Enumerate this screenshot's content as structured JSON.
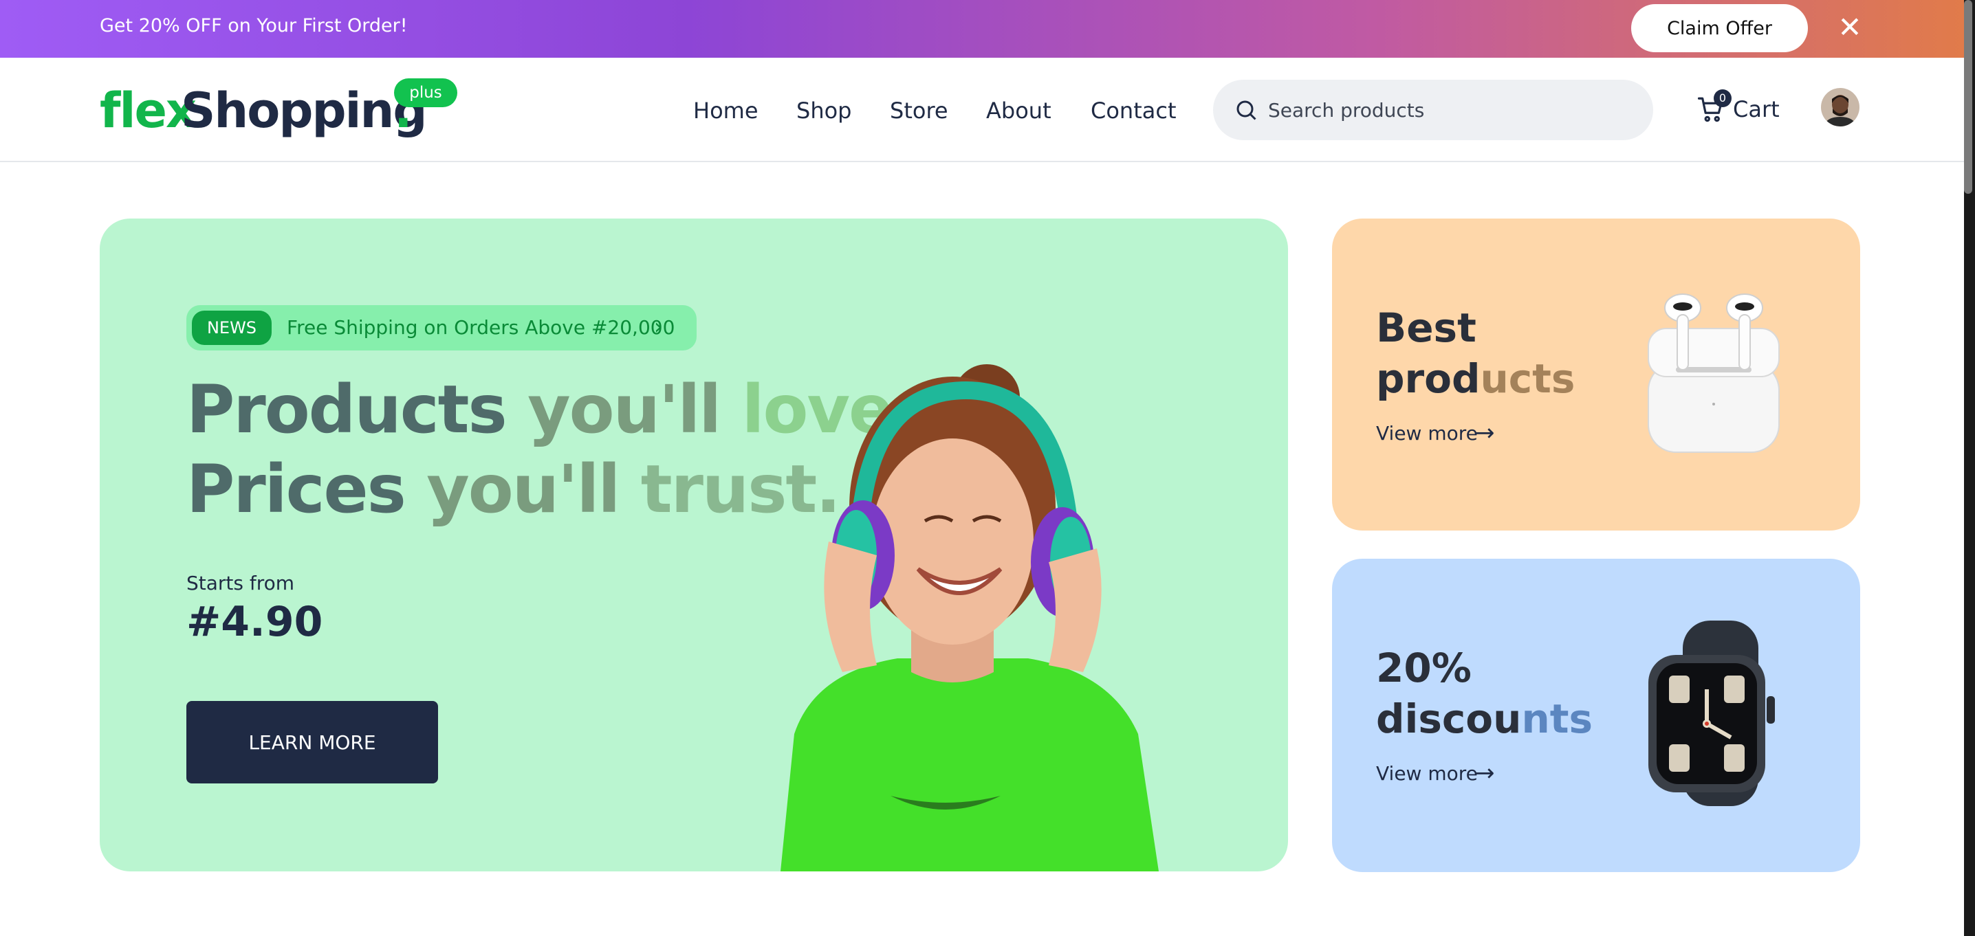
{
  "promo": {
    "text": "Get 20% OFF on Your First Order!",
    "claim_label": "Claim Offer",
    "close_icon": "close-icon",
    "gradient": [
      "#9f5cf5",
      "#e17b4a"
    ]
  },
  "header": {
    "logo": {
      "part1": "flex",
      "part2": "Shopping",
      "dot": ".",
      "badge": "plus"
    },
    "nav": [
      {
        "label": "Home"
      },
      {
        "label": "Shop"
      },
      {
        "label": "Store"
      },
      {
        "label": "About"
      },
      {
        "label": "Contact"
      }
    ],
    "search": {
      "placeholder": "Search products",
      "value": ""
    },
    "cart": {
      "label": "Cart",
      "count": "0"
    },
    "avatar_icon": "user-avatar"
  },
  "hero": {
    "news_tag": "NEWS",
    "news_text": "Free Shipping on Orders Above #20,000",
    "headline_1": {
      "a": "Products ",
      "b": "you'll ",
      "c": "love."
    },
    "headline_2": {
      "a": "Prices ",
      "b": "you'll ",
      "c": "trust."
    },
    "starts_from": "Starts from",
    "price": "#4.90",
    "cta_label": "LEARN MORE",
    "background": "#baf5d0"
  },
  "cards": [
    {
      "title_1": "Best",
      "title_2a": "prod",
      "title_2b": "ucts",
      "link": "View more",
      "background": "#fed7aa",
      "image_icon": "earbuds-image"
    },
    {
      "title_1": "20%",
      "title_2a": "discou",
      "title_2b": "nts",
      "link": "View more",
      "background": "#bfdbfe",
      "image_icon": "smartwatch-image"
    }
  ]
}
